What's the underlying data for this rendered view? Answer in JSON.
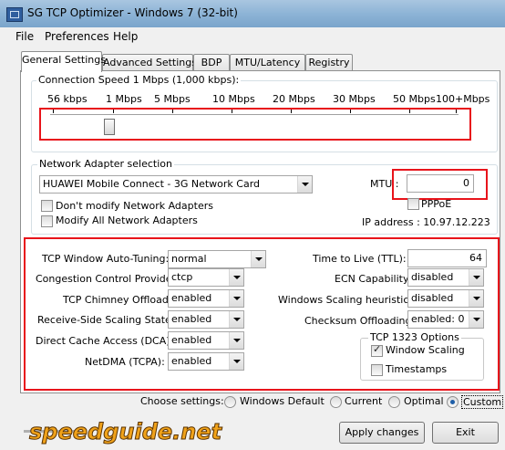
{
  "window": {
    "title": "SG TCP Optimizer - Windows 7 (32-bit)"
  },
  "menu": [
    "File",
    "Preferences",
    "Help"
  ],
  "tabs": [
    "General Settings",
    "Advanced Settings",
    "BDP",
    "MTU/Latency",
    "Registry"
  ],
  "connection_speed": {
    "label": "Connection Speed  1 Mbps (1,000 kbps):",
    "ticks": [
      "56 kbps",
      "1 Mbps",
      "5 Mbps",
      "10 Mbps",
      "20 Mbps",
      "30 Mbps",
      "50 Mbps",
      "100+Mbps"
    ],
    "selected": "1 Mbps"
  },
  "adapter": {
    "label": "Network Adapter selection",
    "selected": "HUAWEI Mobile Connect - 3G Network Card",
    "dont_modify": "Don't modify Network Adapters",
    "modify_all": "Modify All Network Adapters",
    "mtu_label": "MTU :",
    "mtu_value": "0",
    "pppoe": "PPPoE",
    "ip": "IP address : 10.97.12.223"
  },
  "settings_left": [
    {
      "label": "TCP Window Auto-Tuning:",
      "value": "normal"
    },
    {
      "label": "Congestion Control Provider:",
      "value": "ctcp"
    },
    {
      "label": "TCP Chimney Offload:",
      "value": "enabled"
    },
    {
      "label": "Receive-Side Scaling State:",
      "value": "enabled"
    },
    {
      "label": "Direct Cache Access (DCA):",
      "value": "enabled"
    },
    {
      "label": "NetDMA (TCPA):",
      "value": "enabled"
    }
  ],
  "settings_right": [
    {
      "label": "Time to Live (TTL):",
      "value": "64"
    },
    {
      "label": "ECN Capability:",
      "value": "disabled"
    },
    {
      "label": "Windows Scaling heuristics:",
      "value": "disabled"
    },
    {
      "label": "Checksum Offloading:",
      "value": "enabled: 0"
    }
  ],
  "tcp1323": {
    "title": "TCP 1323 Options",
    "window_scaling": "Window Scaling",
    "timestamps": "Timestamps"
  },
  "choose": {
    "label": "Choose settings:",
    "options": [
      "Windows Default",
      "Current",
      "Optimal",
      "Custom"
    ],
    "selected": "Custom"
  },
  "logo": {
    "text": "speedguide.net"
  },
  "buttons": {
    "apply": "Apply changes",
    "exit": "Exit"
  },
  "colors": {
    "highlight": "#e8141b",
    "logo_fill": "#f0a21a"
  }
}
